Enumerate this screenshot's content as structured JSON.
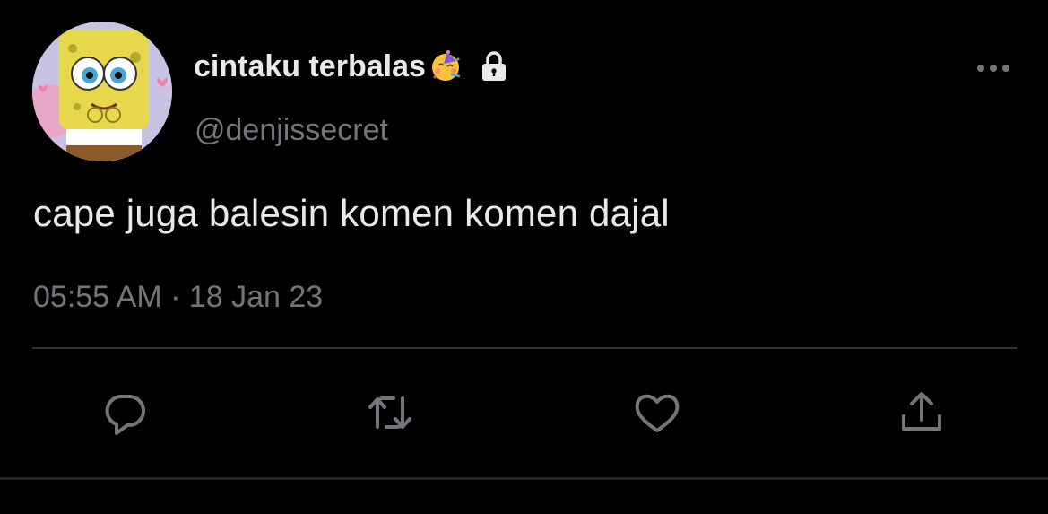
{
  "tweet": {
    "author": {
      "display_name": "cintaku terbalas",
      "handle": "@denjissecret",
      "name_emoji": "partying-face-icon",
      "protected_icon": "lock-icon"
    },
    "text": "cape juga balesin komen komen dajal",
    "timestamp": "05:55 AM · 18 Jan 23"
  },
  "actions": {
    "icons": [
      "reply-icon",
      "retweet-icon",
      "like-icon",
      "share-icon"
    ],
    "more_icon": "more-options-icon"
  },
  "colors": {
    "background": "#000000",
    "primary_text": "#e7e9ea",
    "secondary_text": "#71767b",
    "divider": "#2f3336"
  }
}
